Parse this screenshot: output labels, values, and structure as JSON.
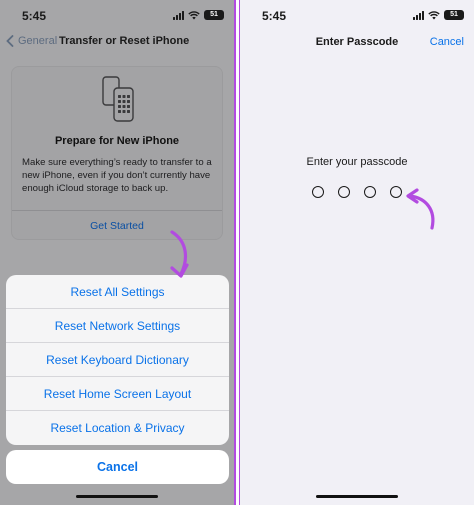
{
  "left_screen": {
    "status": {
      "time": "5:45",
      "battery": "51"
    },
    "nav": {
      "back_label": "General",
      "title": "Transfer or Reset iPhone"
    },
    "card": {
      "title": "Prepare for New iPhone",
      "description": "Make sure everything’s ready to transfer to a new iPhone, even if you don’t currently have enough iCloud storage to back up.",
      "link": "Get Started"
    },
    "action_sheet": {
      "items": [
        {
          "label": "Reset All Settings"
        },
        {
          "label": "Reset Network Settings"
        },
        {
          "label": "Reset Keyboard Dictionary"
        },
        {
          "label": "Reset Home Screen Layout"
        },
        {
          "label": "Reset Location & Privacy"
        }
      ],
      "cancel_label": "Cancel"
    }
  },
  "right_screen": {
    "status": {
      "time": "5:45",
      "battery": "51"
    },
    "nav": {
      "title": "Enter Passcode",
      "cancel_label": "Cancel"
    },
    "prompt": "Enter your passcode",
    "passcode_length": 4
  },
  "colors": {
    "ios_blue": "#0a72e8",
    "annotation_purple": "#b24be0",
    "dimmed_background": "#a6a6a8",
    "passcode_background": "#f1f0f6"
  },
  "icons": [
    "signal-icon",
    "wifi-icon",
    "battery-icon",
    "chevron-left-icon",
    "phone-transfer-icon",
    "annotation-arrow-icon"
  ]
}
